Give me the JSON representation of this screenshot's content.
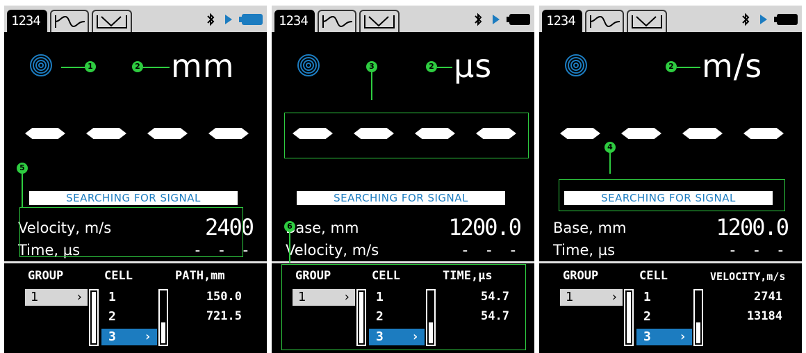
{
  "panels": [
    {
      "tab_numeric": "1234",
      "unit": "mm",
      "search_text": "SEARCHING FOR SIGNAL",
      "row1_label": "Velocity, m/s",
      "row1_value": "2400",
      "row2_label": "Time, µs",
      "row2_value": "- - -",
      "group_header": "GROUP",
      "cell_header": "CELL",
      "value_header": "PATH,mm",
      "group_selected": "1",
      "cells": [
        "1",
        "2",
        "3"
      ],
      "values": [
        "150.0",
        "721.5"
      ]
    },
    {
      "tab_numeric": "1234",
      "unit": "µs",
      "search_text": "SEARCHING FOR SIGNAL",
      "row1_label": "Base, mm",
      "row1_value": "1200.0",
      "row2_label": "Velocity, m/s",
      "row2_value": "- - -",
      "group_header": "GROUP",
      "cell_header": "CELL",
      "value_header": "TIME,µs",
      "group_selected": "1",
      "cells": [
        "1",
        "2",
        "3"
      ],
      "values": [
        "54.7",
        "54.7"
      ]
    },
    {
      "tab_numeric": "1234",
      "unit": "m/s",
      "search_text": "SEARCHING FOR SIGNAL",
      "row1_label": "Base, mm",
      "row1_value": "1200.0",
      "row2_label": "Time, µs",
      "row2_value": "- - -",
      "group_header": "GROUP",
      "cell_header": "CELL",
      "value_header": "VELOCITY,m/s",
      "group_selected": "1",
      "cells": [
        "1",
        "2",
        "3"
      ],
      "values": [
        "2741",
        "13184"
      ]
    }
  ],
  "callouts": {
    "c1": "1",
    "c2": "2",
    "c3": "3",
    "c4": "4",
    "c5": "5",
    "c6": "6"
  },
  "icons": {
    "chevron": "›",
    "bluetooth": "bluetooth-icon",
    "play": "play-icon",
    "battery": "battery-icon",
    "signal_rings": "signal-rings-icon"
  },
  "colors": {
    "accent_blue": "#1c7cc0",
    "annotation_green": "#2ecc40",
    "screen_bg": "#000000",
    "tab_gray": "#d6d6d6"
  }
}
